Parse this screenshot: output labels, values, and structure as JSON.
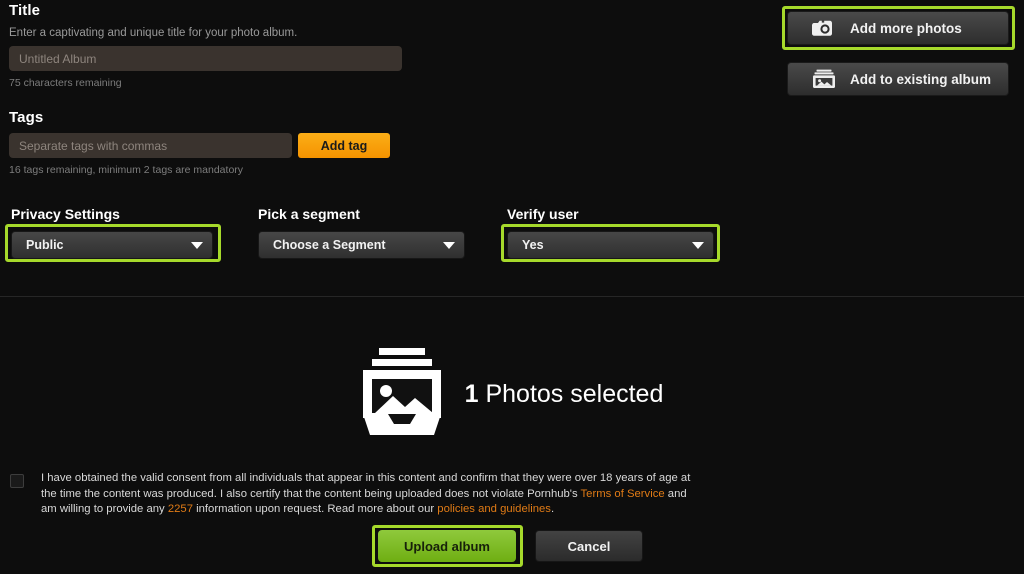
{
  "form": {
    "title_label": "Title",
    "title_help": "Enter a captivating and unique title for your photo album.",
    "title_placeholder": "Untitled Album",
    "title_value": "",
    "title_counter": "75 characters remaining",
    "tags_label": "Tags",
    "tags_placeholder": "Separate tags with commas",
    "tags_value": "",
    "add_tag_label": "Add tag",
    "tags_counter": "16 tags remaining, minimum 2 tags are mandatory"
  },
  "actions": {
    "add_more_photos": "Add more photos",
    "add_more_photos_icon": "camera-icon",
    "add_to_existing_album": "Add to existing album",
    "add_to_existing_album_icon": "album-stack-icon"
  },
  "selectors": [
    {
      "name": "privacy-settings",
      "label": "Privacy Settings",
      "value": "Public",
      "highlighted": true
    },
    {
      "name": "pick-a-segment",
      "label": "Pick a segment",
      "value": "Choose a Segment",
      "highlighted": false
    },
    {
      "name": "verify-user",
      "label": "Verify user",
      "value": "Yes",
      "highlighted": true
    }
  ],
  "photos": {
    "count": "1",
    "label": "Photos selected",
    "icon": "photo-stack-icon"
  },
  "consent": {
    "checked": false,
    "part1": "I have obtained the valid consent from all individuals that appear in this content and confirm that they were over 18 years of age at the time the content was produced. I also certify that the content being uploaded does not violate Pornhub's ",
    "link1": "Terms of Service",
    "part2": " and am willing to provide any ",
    "link2": "2257",
    "part3": " information upon request. Read more about our ",
    "link3": "policies and guidelines",
    "part4": "."
  },
  "footer": {
    "upload_label": "Upload album",
    "cancel_label": "Cancel"
  },
  "colors": {
    "background": "#0d0d0d",
    "highlight_ring": "#a6d92b",
    "accent_orange": "#f59300",
    "link_orange": "#e07b16",
    "upload_green": "#7cbb22",
    "input_background": "#3a332e"
  }
}
